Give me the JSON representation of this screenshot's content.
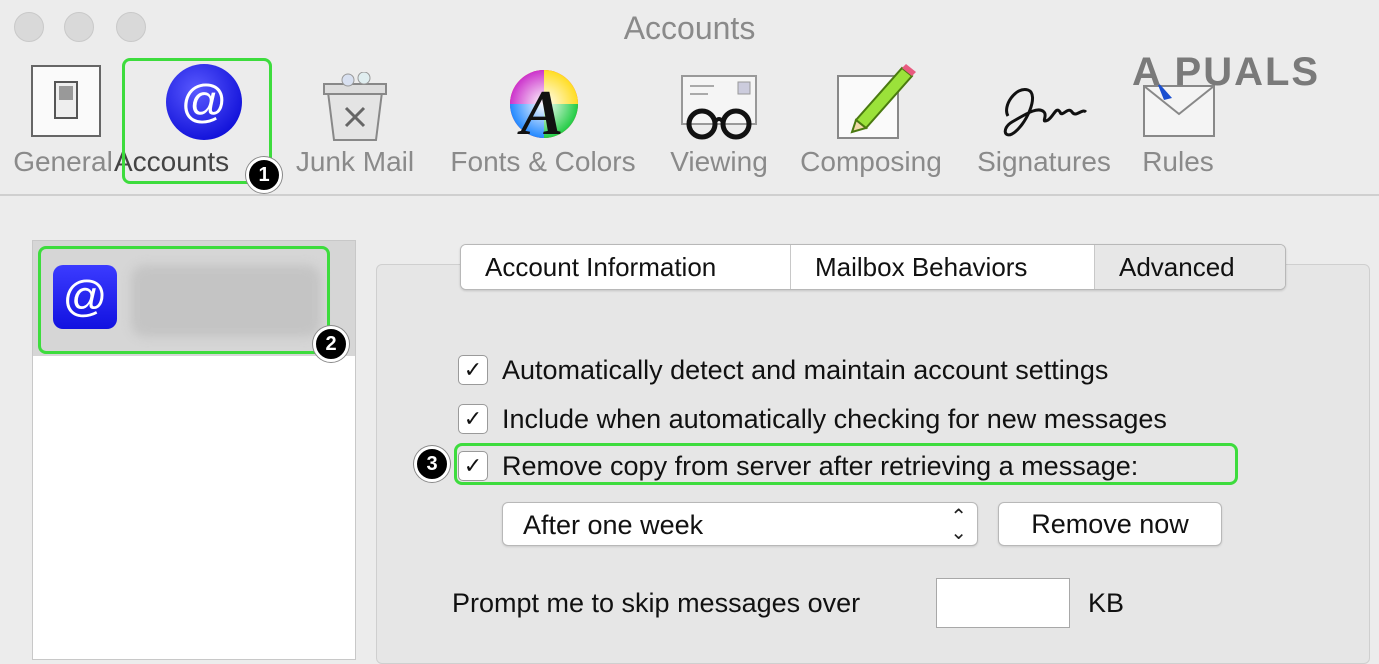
{
  "window": {
    "title": "Accounts"
  },
  "toolbar": {
    "items": [
      {
        "label": "General",
        "icon": "switch-icon"
      },
      {
        "label": "Accounts",
        "icon": "at-sign-icon"
      },
      {
        "label": "Junk Mail",
        "icon": "trash-bin-icon"
      },
      {
        "label": "Fonts & Colors",
        "icon": "font-colors-icon"
      },
      {
        "label": "Viewing",
        "icon": "glasses-icon"
      },
      {
        "label": "Composing",
        "icon": "pencil-icon"
      },
      {
        "label": "Signatures",
        "icon": "signature-icon"
      },
      {
        "label": "Rules",
        "icon": "envelope-icon"
      }
    ],
    "selected": "Accounts"
  },
  "badges": [
    "1",
    "2",
    "3"
  ],
  "account_list": {
    "icon": "at-sign-icon",
    "icon_glyph": "@"
  },
  "tabs": [
    {
      "label": "Account Information"
    },
    {
      "label": "Mailbox Behaviors"
    },
    {
      "label": "Advanced"
    }
  ],
  "options": {
    "auto_detect": {
      "label": "Automatically detect and maintain account settings",
      "checked": true
    },
    "include_checking": {
      "label": "Include when automatically checking for new messages",
      "checked": true
    },
    "remove_copy": {
      "label": "Remove copy from server after retrieving a message:",
      "checked": true
    }
  },
  "remove_period": {
    "selected": "After one week"
  },
  "remove_now_button": "Remove now",
  "skip_prompt": {
    "label": "Prompt me to skip messages over",
    "value": "",
    "unit": "KB"
  },
  "watermark": "A  PUALS",
  "colors": {
    "highlight": "#3ddc3d",
    "accent_blue": "#1a1aee"
  }
}
